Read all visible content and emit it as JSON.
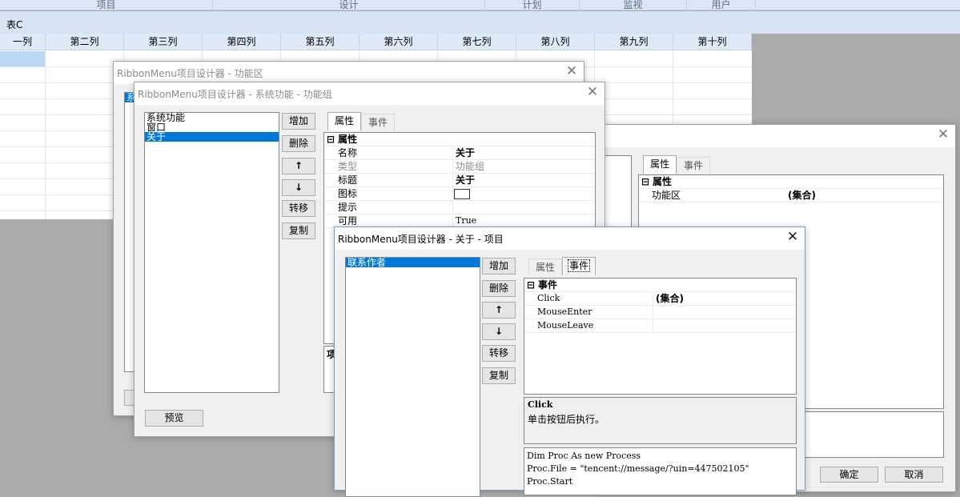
{
  "ribbon": {
    "groups": [
      "项目",
      "设计",
      "计划",
      "监视",
      "用户"
    ],
    "sheet_tab": "表C"
  },
  "grid": {
    "columns": [
      "一列",
      "第二列",
      "第三列",
      "第四列",
      "第五列",
      "第六列",
      "第七列",
      "第八列",
      "第九列",
      "第十列"
    ]
  },
  "win_area": {
    "title": "RibbonMenu项目设计器 - 功能区",
    "close": "✕",
    "list_hint": "系"
  },
  "win_right": {
    "close": "✕",
    "tabs": [
      "属性",
      "事件"
    ],
    "cat": "属性",
    "rows": [
      {
        "name": "功能区",
        "value": "(集合)"
      }
    ],
    "ok": "确定",
    "cancel": "取消"
  },
  "win_group": {
    "title": "RibbonMenu项目设计器 - 系统功能 - 功能组",
    "close": "✕",
    "items": [
      "系统功能",
      "窗口",
      "关于"
    ],
    "selected": 2,
    "buttons": [
      "增加",
      "删除",
      "↑",
      "↓",
      "转移",
      "复制"
    ],
    "preview": "预览",
    "tabs": [
      "属性",
      "事件"
    ],
    "cat": "属性",
    "rows": [
      {
        "name": "名称",
        "value": "关于",
        "bold": true
      },
      {
        "name": "类型",
        "value": "功能组",
        "grey": true
      },
      {
        "name": "标题",
        "value": "关于",
        "bold": true
      },
      {
        "name": "图标",
        "value": ""
      },
      {
        "name": "提示",
        "value": ""
      },
      {
        "name": "可用",
        "value": "True"
      }
    ],
    "desc_hint": "项"
  },
  "win_item": {
    "title": "RibbonMenu项目设计器 - 关于 - 项目",
    "close": "✕",
    "items": [
      "联系作者"
    ],
    "buttons": [
      "增加",
      "删除",
      "↑",
      "↓",
      "转移",
      "复制"
    ],
    "tabs": [
      "属性",
      "事件"
    ],
    "cat": "事件",
    "rows": [
      {
        "name": "Click",
        "value": "(集合)"
      },
      {
        "name": "MouseEnter",
        "value": ""
      },
      {
        "name": "MouseLeave",
        "value": ""
      }
    ],
    "desc_title": "Click",
    "desc_text": "单击按钮后执行。",
    "code": [
      "Dim Proc As new Process",
      "Proc.File = \"tencent://message/?uin=447502105\"",
      "Proc.Start"
    ]
  }
}
